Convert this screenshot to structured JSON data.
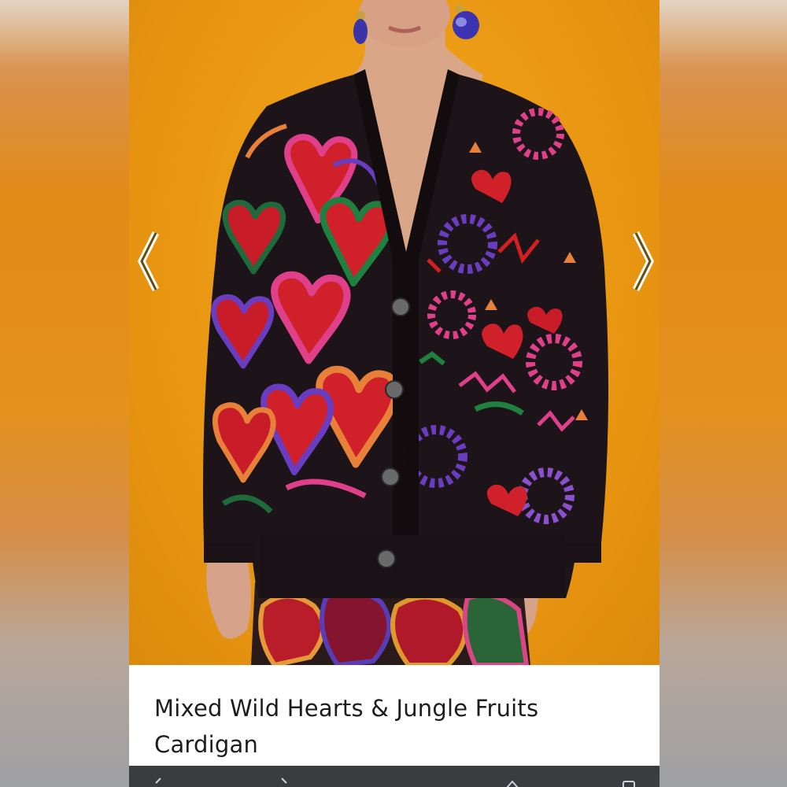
{
  "product": {
    "title_line1": "Mixed Wild Hearts & Jungle Fruits",
    "title_line2": "Cardigan"
  },
  "gallery": {
    "prev_icon": "chevron-left-icon",
    "next_icon": "chevron-right-icon"
  },
  "colors": {
    "background_orange": "#e99712",
    "cardigan_black": "#1c1418",
    "heart_red": "#d0202a",
    "pink": "#e0408a",
    "purple": "#6a3cc0",
    "green": "#1f6a3a",
    "toolbar": "#3a3c40"
  }
}
